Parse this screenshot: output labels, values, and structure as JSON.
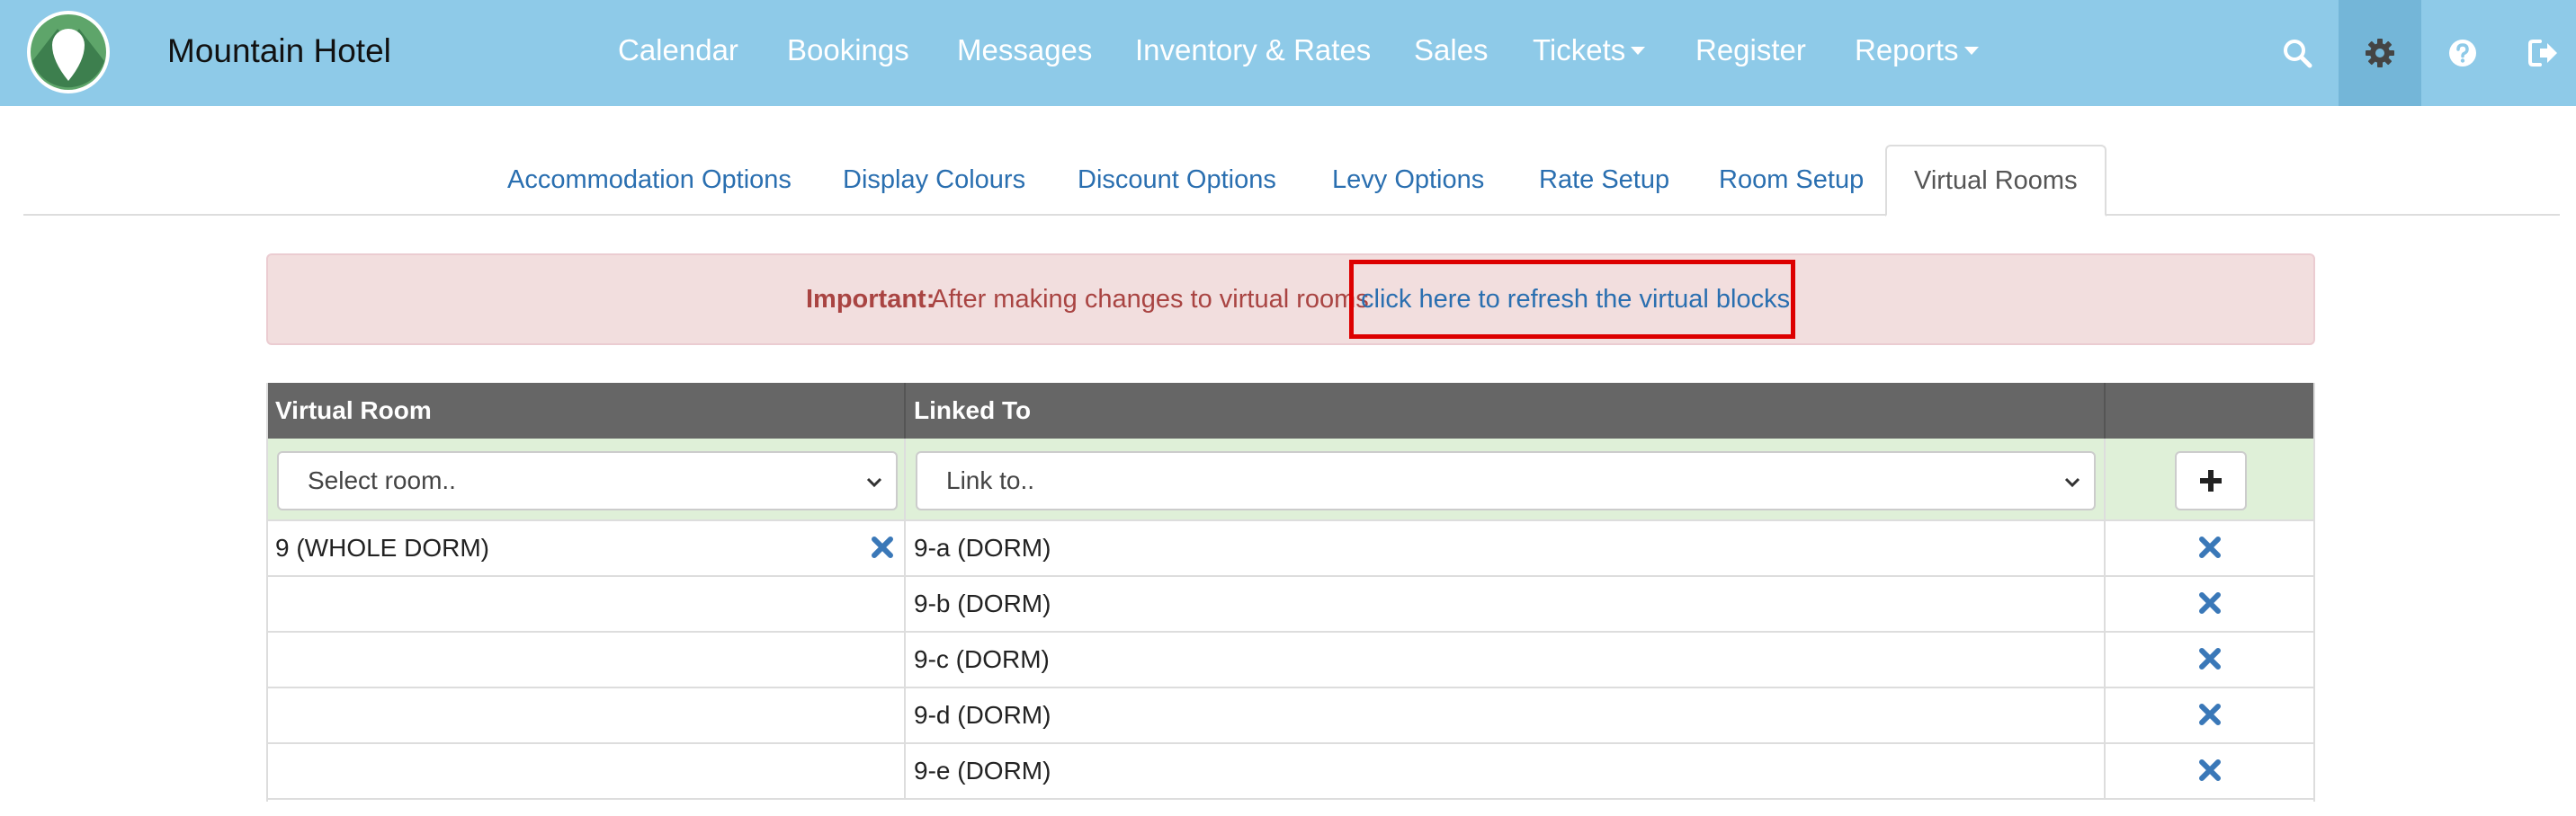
{
  "navbar": {
    "brand": "Mountain Hotel",
    "items": [
      {
        "label": "Calendar"
      },
      {
        "label": "Bookings"
      },
      {
        "label": "Messages"
      },
      {
        "label": "Inventory & Rates"
      },
      {
        "label": "Sales"
      },
      {
        "label": "Tickets",
        "dropdown": true
      },
      {
        "label": "Register"
      },
      {
        "label": "Reports",
        "dropdown": true
      }
    ],
    "icons": [
      "search-icon",
      "gear-icon",
      "help-icon",
      "logout-icon"
    ],
    "active_icon": "gear-icon"
  },
  "tabs": [
    {
      "label": "Accommodation Options"
    },
    {
      "label": "Display Colours"
    },
    {
      "label": "Discount Options"
    },
    {
      "label": "Levy Options"
    },
    {
      "label": "Rate Setup"
    },
    {
      "label": "Room Setup"
    },
    {
      "label": "Virtual Rooms",
      "active": true
    }
  ],
  "alert": {
    "strong": "Important:",
    "text": "After making changes to virtual rooms",
    "link": "click here to refresh the virtual blocks."
  },
  "table": {
    "headers": {
      "virtual_room": "Virtual Room",
      "linked_to": "Linked To",
      "actions": ""
    },
    "room_select_placeholder": "Select room..",
    "link_select_placeholder": "Link to..",
    "rows": [
      {
        "virtual_room": "9 (WHOLE DORM)",
        "linked_to": "9-a (DORM)"
      },
      {
        "virtual_room": "",
        "linked_to": "9-b (DORM)"
      },
      {
        "virtual_room": "",
        "linked_to": "9-c (DORM)"
      },
      {
        "virtual_room": "",
        "linked_to": "9-d (DORM)"
      },
      {
        "virtual_room": "",
        "linked_to": "9-e (DORM)"
      }
    ]
  },
  "colors": {
    "navbar": "#8ecae8",
    "link": "#2a6fb0",
    "alert_bg": "#f2dede",
    "alert_text": "#a94442",
    "table_header": "#666666",
    "input_row": "#dff0d8",
    "highlight": "#dd0000"
  }
}
